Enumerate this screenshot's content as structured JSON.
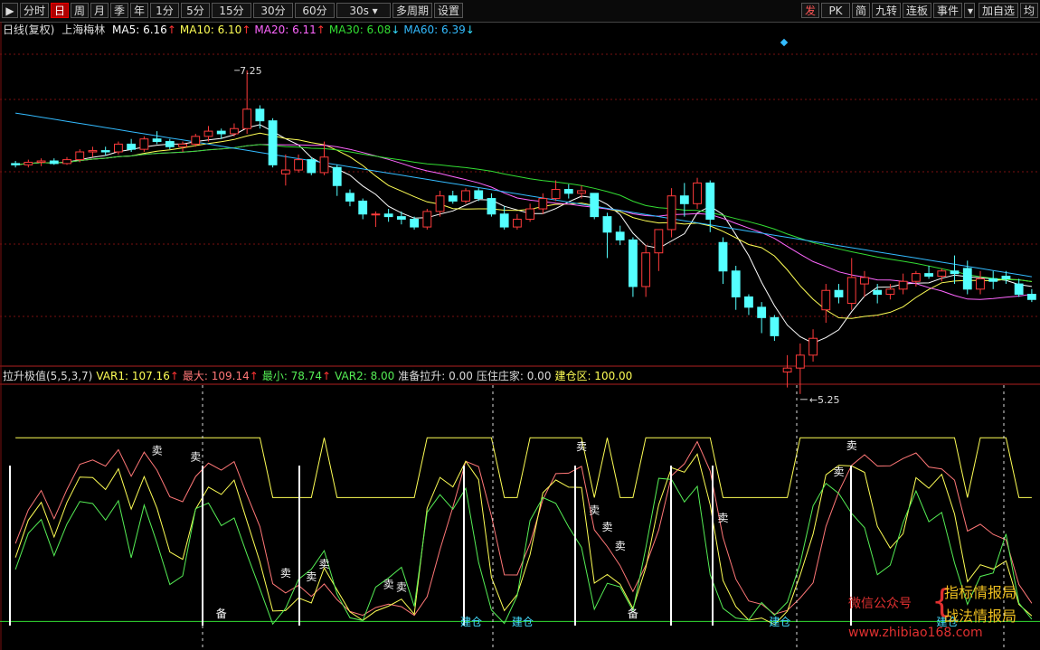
{
  "toolbar": {
    "left": [
      "分时",
      "日",
      "周",
      "月",
      "季",
      "年",
      "1分",
      "5分",
      "15分",
      "30分",
      "60分",
      "30s",
      "多周期",
      "设置"
    ],
    "active": "日",
    "right": [
      "发",
      "PK",
      "简",
      "九转",
      "连板",
      "事件",
      "加自选",
      "均"
    ]
  },
  "main_legend": {
    "period": "日线(复权)",
    "stock": "上海梅林",
    "ma": [
      {
        "label": "MA5: 6.16",
        "arrow": "↑",
        "color": "#ffffff",
        "arrow_color": "#ff3333"
      },
      {
        "label": "MA10: 6.10",
        "arrow": "↑",
        "color": "#ffff55",
        "arrow_color": "#ff3333"
      },
      {
        "label": "MA20: 6.11",
        "arrow": "↑",
        "color": "#ff66ff",
        "arrow_color": "#ff3333"
      },
      {
        "label": "MA30: 6.08",
        "arrow": "↓",
        "color": "#33dd33",
        "arrow_color": "#33ddff"
      },
      {
        "label": "MA60: 6.39",
        "arrow": "↓",
        "color": "#33bbff",
        "arrow_color": "#33ddff"
      }
    ]
  },
  "indicator_legend": [
    {
      "label": "拉升极值(5,5,3,7)",
      "color": "#dddddd"
    },
    {
      "label": "VAR1: 107.16",
      "arrow": "↑",
      "color": "#ffff55",
      "arrow_color": "#ff3333"
    },
    {
      "label": "最大: 109.14",
      "arrow": "↑",
      "color": "#ff7777",
      "arrow_color": "#ff3333"
    },
    {
      "label": "最小: 78.74",
      "arrow": "↑",
      "color": "#55ee55",
      "arrow_color": "#ff3333"
    },
    {
      "label": "VAR2: 8.00",
      "color": "#55ee55"
    },
    {
      "label": "准备拉升: 0.00",
      "color": "#dddddd"
    },
    {
      "label": "压住庄家: 0.00",
      "color": "#dddddd"
    },
    {
      "label": "建仓区: 100.00",
      "color": "#ffff55"
    }
  ],
  "chart_data": {
    "type": "candlestick",
    "y_range": [
      5.0,
      7.5
    ],
    "annotations": {
      "high_label": "7.25",
      "low_label": "5.25"
    },
    "candles": [
      [
        6.53,
        6.55,
        6.5,
        6.52
      ],
      [
        6.52,
        6.56,
        6.5,
        6.54
      ],
      [
        6.54,
        6.57,
        6.51,
        6.55
      ],
      [
        6.55,
        6.57,
        6.52,
        6.53
      ],
      [
        6.53,
        6.58,
        6.52,
        6.56
      ],
      [
        6.56,
        6.64,
        6.54,
        6.62
      ],
      [
        6.62,
        6.66,
        6.58,
        6.63
      ],
      [
        6.63,
        6.66,
        6.59,
        6.62
      ],
      [
        6.62,
        6.7,
        6.6,
        6.68
      ],
      [
        6.68,
        6.72,
        6.62,
        6.64
      ],
      [
        6.64,
        6.74,
        6.62,
        6.72
      ],
      [
        6.72,
        6.78,
        6.68,
        6.7
      ],
      [
        6.7,
        6.72,
        6.64,
        6.66
      ],
      [
        6.66,
        6.7,
        6.62,
        6.68
      ],
      [
        6.68,
        6.76,
        6.66,
        6.74
      ],
      [
        6.74,
        6.82,
        6.7,
        6.78
      ],
      [
        6.78,
        6.8,
        6.72,
        6.76
      ],
      [
        6.76,
        6.84,
        6.74,
        6.8
      ],
      [
        6.8,
        7.25,
        6.76,
        6.95
      ],
      [
        6.95,
        6.98,
        6.8,
        6.86
      ],
      [
        6.86,
        6.88,
        6.5,
        6.52
      ],
      [
        6.45,
        6.6,
        6.36,
        6.48
      ],
      [
        6.48,
        6.6,
        6.46,
        6.56
      ],
      [
        6.56,
        6.58,
        6.44,
        6.46
      ],
      [
        6.46,
        6.7,
        6.44,
        6.58
      ],
      [
        6.5,
        6.52,
        6.28,
        6.36
      ],
      [
        6.3,
        6.33,
        6.2,
        6.24
      ],
      [
        6.24,
        6.26,
        6.1,
        6.14
      ],
      [
        6.14,
        6.16,
        6.04,
        6.14
      ],
      [
        6.14,
        6.18,
        6.08,
        6.12
      ],
      [
        6.12,
        6.16,
        6.06,
        6.1
      ],
      [
        6.1,
        6.12,
        6.02,
        6.04
      ],
      [
        6.04,
        6.18,
        6.02,
        6.16
      ],
      [
        6.16,
        6.32,
        6.12,
        6.28
      ],
      [
        6.28,
        6.32,
        6.22,
        6.24
      ],
      [
        6.24,
        6.34,
        6.22,
        6.32
      ],
      [
        6.32,
        6.34,
        6.24,
        6.26
      ],
      [
        6.26,
        6.3,
        6.12,
        6.14
      ],
      [
        6.14,
        6.2,
        6.02,
        6.04
      ],
      [
        6.04,
        6.14,
        6.02,
        6.1
      ],
      [
        6.1,
        6.22,
        6.08,
        6.18
      ],
      [
        6.18,
        6.3,
        6.14,
        6.26
      ],
      [
        6.26,
        6.4,
        6.24,
        6.33
      ],
      [
        6.33,
        6.37,
        6.26,
        6.3
      ],
      [
        6.3,
        6.36,
        6.26,
        6.32
      ],
      [
        6.3,
        6.28,
        6.1,
        6.12
      ],
      [
        6.12,
        6.15,
        5.8,
        6.0
      ],
      [
        6.0,
        6.05,
        5.9,
        5.94
      ],
      [
        5.94,
        5.96,
        5.5,
        5.58
      ],
      [
        5.58,
        5.9,
        5.5,
        5.84
      ],
      [
        5.84,
        6.0,
        5.7,
        6.02
      ],
      [
        6.02,
        6.34,
        5.96,
        6.28
      ],
      [
        6.28,
        6.38,
        6.12,
        6.22
      ],
      [
        6.22,
        6.42,
        6.18,
        6.38
      ],
      [
        6.38,
        6.4,
        6.0,
        6.1
      ],
      [
        5.92,
        5.96,
        5.6,
        5.7
      ],
      [
        5.7,
        5.74,
        5.4,
        5.5
      ],
      [
        5.5,
        5.52,
        5.36,
        5.42
      ],
      [
        5.42,
        5.46,
        5.22,
        5.34
      ],
      [
        5.34,
        5.36,
        5.16,
        5.2
      ],
      [
        4.92,
        5.05,
        4.8,
        4.95
      ],
      [
        4.95,
        5.14,
        4.75,
        5.05
      ],
      [
        5.05,
        5.25,
        5.0,
        5.18
      ],
      [
        5.4,
        5.6,
        5.3,
        5.55
      ],
      [
        5.55,
        5.6,
        5.45,
        5.5
      ],
      [
        5.45,
        5.8,
        5.4,
        5.65
      ],
      [
        5.6,
        5.7,
        5.5,
        5.65
      ],
      [
        5.55,
        5.6,
        5.45,
        5.52
      ],
      [
        5.52,
        5.6,
        5.48,
        5.56
      ],
      [
        5.56,
        5.68,
        5.52,
        5.62
      ],
      [
        5.62,
        5.7,
        5.58,
        5.68
      ],
      [
        5.68,
        5.74,
        5.64,
        5.66
      ],
      [
        5.66,
        5.72,
        5.62,
        5.7
      ],
      [
        5.7,
        5.82,
        5.6,
        5.68
      ],
      [
        5.72,
        5.78,
        5.52,
        5.56
      ],
      [
        5.56,
        5.7,
        5.52,
        5.64
      ],
      [
        5.64,
        5.7,
        5.56,
        5.62
      ],
      [
        5.66,
        5.7,
        5.6,
        5.64
      ],
      [
        5.6,
        5.64,
        5.5,
        5.52
      ],
      [
        5.52,
        5.56,
        5.46,
        5.48
      ]
    ],
    "ma_lines": [
      {
        "name": "MA5",
        "color": "#ffffff"
      },
      {
        "name": "MA10",
        "color": "#ffff55"
      },
      {
        "name": "MA20",
        "color": "#ff66ff"
      },
      {
        "name": "MA30",
        "color": "#33dd33"
      },
      {
        "name": "MA60",
        "color": "#33bbff"
      }
    ],
    "indicator": {
      "y_range": [
        0,
        120
      ],
      "var1_color": "#ffff55",
      "max_color": "#ff7777",
      "min_color": "#55ee55",
      "var2_color": "#55ee55",
      "signals": [
        {
          "text": "卖",
          "i": 11
        },
        {
          "text": "卖",
          "i": 14
        },
        {
          "text": "卖",
          "i": 21
        },
        {
          "text": "卖",
          "i": 23
        },
        {
          "text": "卖",
          "i": 24
        },
        {
          "text": "卖",
          "i": 29
        },
        {
          "text": "卖",
          "i": 30
        },
        {
          "text": "卖",
          "i": 44
        },
        {
          "text": "卖",
          "i": 45
        },
        {
          "text": "卖",
          "i": 46
        },
        {
          "text": "卖",
          "i": 47
        },
        {
          "text": "卖",
          "i": 55
        },
        {
          "text": "卖",
          "i": 64
        },
        {
          "text": "卖",
          "i": 65
        },
        {
          "text": "卖",
          "i": 83
        },
        {
          "text": "备",
          "i": 16
        },
        {
          "text": "备",
          "i": 48
        },
        {
          "text": "建仓",
          "i": 35
        },
        {
          "text": "建仓",
          "i": 39
        },
        {
          "text": "建仓",
          "i": 59
        },
        {
          "text": "建仓",
          "i": 72
        }
      ]
    }
  },
  "watermark": {
    "line1": "微信公众号",
    "line2": "指标情报局",
    "line3": "战法情报局",
    "line4": "www.zhibiao168.com"
  }
}
